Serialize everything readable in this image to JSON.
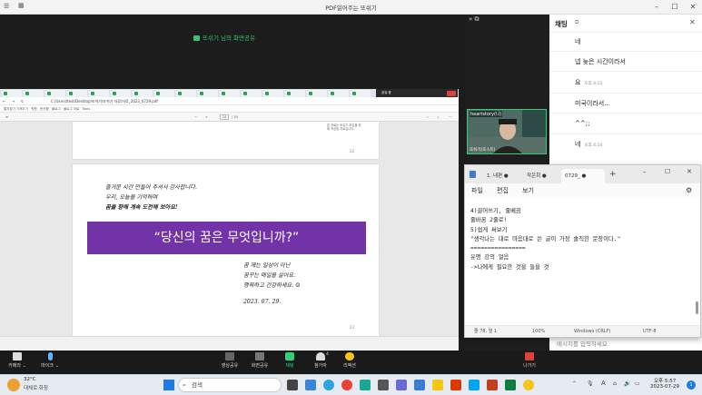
{
  "window": {
    "title": "PDF읽어주는 또쉬기",
    "minimize": "–",
    "maximize": "☐",
    "close": "✕"
  },
  "share_indicator": "또쉬기 님의 화면공유",
  "browser": {
    "address": "C:/Users/test/Desktop/또쉬기/또쉬기 자료/자료_2023_0729.pdf",
    "bookmarks": [
      "즐겨찾기 가져오기",
      "학원",
      "문서함",
      "블로그",
      "블로그 자료",
      "Tools"
    ],
    "pdf_page": "24",
    "pdf_page_total": "/ 25",
    "share_toolbar": "공유 중",
    "share_stop": "중지"
  },
  "pdf": {
    "page1_number": "22",
    "thumb_note": "본 자료는 또쉬기 모임을 위해 작성된 자료입니다.",
    "lines": [
      "즐거운 시간 만들어 주셔서 감사합니다.",
      "우리, 오늘을 기억하며",
      "꿈을 향해 계속 도전해 보아요!"
    ],
    "banner": "“당신의 꿈은 무엇입니까?”",
    "closing": [
      "꿈 께는 일상이 아닌",
      "꿈꾸는 매일을 살아요.",
      "행복하고 건강하세요. ☺"
    ],
    "date": "2023. 07. 29.",
    "page2_number": "23"
  },
  "video": {
    "tile_label": "heartstory(나)",
    "tile_name": "또쉬기(호스트)"
  },
  "chat": {
    "title": "채팅",
    "messages": [
      {
        "text": "네",
        "time": ""
      },
      {
        "text": "넵 늦은 시간이라서",
        "time": ""
      },
      {
        "text": "요",
        "time": "오후 4:13"
      },
      {
        "text": "미국이라서...",
        "time": ""
      },
      {
        "text": "^^;;",
        "time": ""
      },
      {
        "text": "네",
        "time": "오후 4:14"
      }
    ],
    "input_placeholder": "메시지를 입력하세요"
  },
  "notepad": {
    "tabs": [
      "1. 내편",
      "작은회",
      "0729_"
    ],
    "menu": [
      "파일",
      "편집",
      "보기"
    ],
    "lines": [
      "4)끌어쓰기, 줄베끔",
      "줄바꿈 2줄로!",
      "",
      "5)쉽게 써보기",
      "\"생각나는 대로 마음대로 쓴 글이 가장 솔직한 문장이다.\"",
      "",
      "================",
      "",
      "유명 강의 얼음",
      "->나에게 필요한 것을 들을 것"
    ],
    "status": {
      "position": "줄 78, 열 1",
      "zoom": "100%",
      "eol": "Windows (CRLF)",
      "encoding": "UTF-8"
    }
  },
  "zoombar": {
    "camera": "카메라",
    "mic": "마이크",
    "share": "영상공유",
    "screen": "화면공유",
    "chat": "채팅",
    "participants": "참가자",
    "participants_count": "4",
    "reactions": "리액션",
    "leave": "나가기"
  },
  "taskbar": {
    "weather_temp": "32°C",
    "weather_desc": "대체로 화창",
    "search": "검색",
    "time": "오후 5:57",
    "date": "2023-07-29",
    "lang": "A"
  },
  "colors": {
    "accent": "#2fd07a",
    "banner": "#7232a8",
    "leave": "#e0403a"
  }
}
